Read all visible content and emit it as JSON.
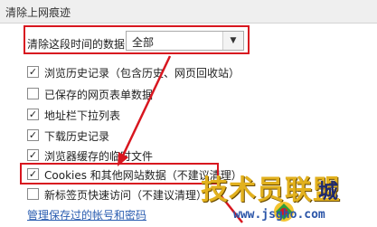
{
  "window": {
    "title": "清除上网痕迹"
  },
  "time_range": {
    "label": "清除这段时间的数据：",
    "selected": "全部"
  },
  "options": [
    {
      "label": "浏览历史记录（包含历史、网页回收站）",
      "checked": true
    },
    {
      "label": "已保存的网页表单数据",
      "checked": false
    },
    {
      "label": "地址栏下拉列表",
      "checked": true
    },
    {
      "label": "下载历史记录",
      "checked": true
    },
    {
      "label": "浏览器缓存的临时文件",
      "checked": true
    },
    {
      "label": "Cookies 和其他网站数据（不建议清理）",
      "checked": true
    },
    {
      "label": "新标签页快速访问（不建议清理）",
      "checked": false
    }
  ],
  "manage_link": "管理保存过的帐号和密码",
  "watermark": {
    "main": "技术员联盟",
    "sub": "城",
    "url": "www.jsgho.com"
  },
  "colors": {
    "highlight": "#d8161f",
    "link": "#2a5db0"
  }
}
